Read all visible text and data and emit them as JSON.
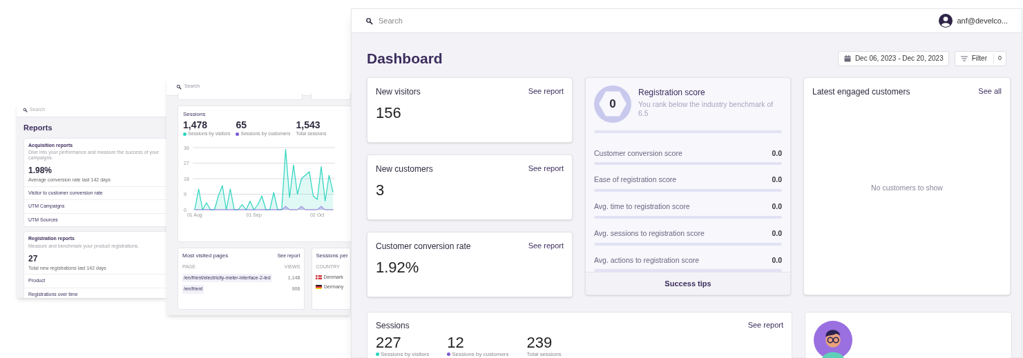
{
  "reports_screen": {
    "search": {
      "placeholder": "Search"
    },
    "title": "Reports",
    "cards": [
      {
        "title": "Acquisition reports",
        "description": "Dive into your performance and measure the success of your campaigns.",
        "value": "1.98%",
        "caption": "Average conversion rate last 142 days",
        "links": [
          "Visitor to customer conversion rate",
          "UTM Campaigns",
          "UTM Sources"
        ]
      },
      {
        "title": "Registration reports",
        "description": "Measure and benchmark your product registrations.",
        "value": "27",
        "caption": "Total new registrations last 142 days",
        "links": [
          "Product",
          "Registrations over time"
        ]
      }
    ]
  },
  "sessions_screen": {
    "search": {
      "placeholder": "Search"
    },
    "sessions": {
      "title": "Sessions",
      "stats": [
        {
          "value": "1,478"
        },
        {
          "value": "65"
        },
        {
          "value": "1,543",
          "label": "Total sessions"
        }
      ],
      "chart_data": {
        "type": "area",
        "grid": true,
        "legend": true,
        "ylim": [
          0,
          36
        ],
        "categories": [
          "01 Aug",
          null,
          null,
          null,
          null,
          null,
          null,
          null,
          null,
          null,
          null,
          null,
          null,
          null,
          null,
          "01 Sep",
          null,
          null,
          null,
          null,
          null,
          null,
          null,
          null,
          null,
          null,
          null,
          null,
          null,
          null,
          null,
          "02 Oct",
          null,
          null,
          null,
          null
        ],
        "yticks": [
          0,
          9,
          18,
          27,
          36
        ],
        "series": [
          {
            "name": "Sessions by visitors",
            "color": "#2dd4bf",
            "values": [
              0,
              12,
              0,
              4,
              0,
              0,
              8,
              14,
              0,
              12,
              0,
              0,
              3,
              0,
              5,
              0,
              3,
              8,
              0,
              0,
              10,
              0,
              0,
              35,
              7,
              26,
              9,
              18,
              20,
              22,
              8,
              6,
              25,
              5,
              20,
              10
            ]
          },
          {
            "name": "Sessions by customers",
            "color": "#7c5cd6",
            "values": [
              0,
              0,
              0,
              0,
              0,
              0,
              0,
              0,
              0,
              0,
              0,
              0,
              0,
              0,
              0,
              0,
              0,
              0,
              0,
              0,
              0,
              0,
              0,
              2,
              0,
              0,
              0,
              2,
              0,
              0,
              0,
              0,
              2,
              0,
              0,
              0
            ]
          }
        ]
      }
    },
    "most_visited_pages": {
      "title": "Most visited pages",
      "link": "See report",
      "columns": [
        "PAGE",
        "VIEWS"
      ],
      "rows": [
        {
          "page": "/en/frient/electricity-meter-interface-2-led",
          "views": "1,148"
        },
        {
          "page": "/en/frient",
          "views": "906"
        }
      ]
    },
    "sessions_per_country": {
      "title": "Sessions per",
      "columns": [
        "COUNTRY"
      ],
      "rows": [
        {
          "country": "Denmark",
          "kind": "denmark"
        },
        {
          "country": "Germany",
          "kind": "germany"
        }
      ]
    }
  },
  "dashboard_screen": {
    "search": {
      "placeholder": "Search"
    },
    "user": "anf@develco...",
    "title": "Dashboard",
    "date_range": "Dec 06, 2023 - Dec 20, 2023",
    "filter": {
      "label": "Filter",
      "count": "0"
    },
    "metrics": [
      {
        "title": "New visitors",
        "value": "156",
        "link": "See report"
      },
      {
        "title": "New customers",
        "value": "3",
        "link": "See report"
      },
      {
        "title": "Customer conversion rate",
        "value": "1.92%",
        "link": "See report"
      }
    ],
    "registration_score": {
      "score": "0",
      "title": "Registration score",
      "description": "You rank below the industry benchmark of 6.5",
      "level": 0,
      "items": [
        {
          "label": "Customer conversion score",
          "value": "0.0",
          "level": 0
        },
        {
          "label": "Ease of registration score",
          "value": "0.0",
          "level": 0
        },
        {
          "label": "Avg. time to registration score",
          "value": "0.0",
          "level": 0
        },
        {
          "label": "Avg. sessions to registration score",
          "value": "0.0",
          "level": 0
        },
        {
          "label": "Avg. actions to registration score",
          "value": "0.0",
          "level": 0
        }
      ],
      "footer": "Success tips"
    },
    "latest_customers": {
      "title": "Latest engaged customers",
      "link": "See all",
      "empty": "No customers to show"
    },
    "sessions": {
      "title": "Sessions",
      "link": "See report",
      "stats": [
        {
          "value": "227",
          "label": "Sessions by visitors",
          "color": "#2dd4bf"
        },
        {
          "value": "12",
          "label": "Sessions by customers",
          "color": "#7c5cd6"
        },
        {
          "value": "239",
          "label": "Total sessions"
        }
      ]
    }
  }
}
